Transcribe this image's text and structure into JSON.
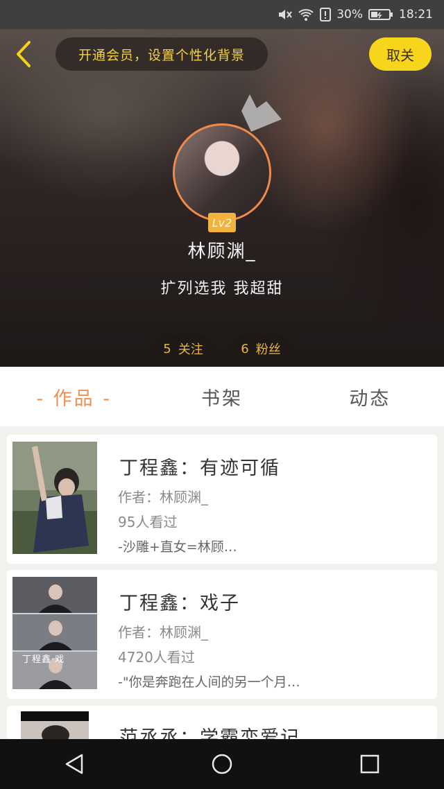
{
  "status_bar": {
    "battery": "30%",
    "time": "18:21",
    "icons": [
      "mute-icon",
      "wifi-icon",
      "alert-icon",
      "battery-icon"
    ]
  },
  "header": {
    "vip_prompt": "开通会员，设置个性化背景",
    "unfollow_label": "取关"
  },
  "profile": {
    "level": "Lv2",
    "username": "林顾渊_",
    "signature": "扩列选我 我超甜",
    "following_count": "5",
    "following_label": "关注",
    "fans_count": "6",
    "fans_label": "粉丝"
  },
  "tabs": [
    {
      "label": "- 作品 -",
      "active": true
    },
    {
      "label": "书架",
      "active": false
    },
    {
      "label": "动态",
      "active": false
    }
  ],
  "works": [
    {
      "title": "丁程鑫：有迹可循",
      "author": "作者：林顾渊_",
      "views": "95人看过",
      "snippet": "-沙雕+直女=林顾…"
    },
    {
      "title": "丁程鑫：戏子",
      "author": "作者：林顾渊_",
      "views": "4720人看过",
      "snippet": "-\"你是奔跑在人间的另一个月…",
      "thumb_caption": "丁程鑫·戏"
    },
    {
      "title": "范丞丞：学霸恋爱记"
    }
  ],
  "colors": {
    "accent": "#ee8f4d",
    "yellow": "#f7d51d",
    "gold_text": "#e9b640"
  }
}
